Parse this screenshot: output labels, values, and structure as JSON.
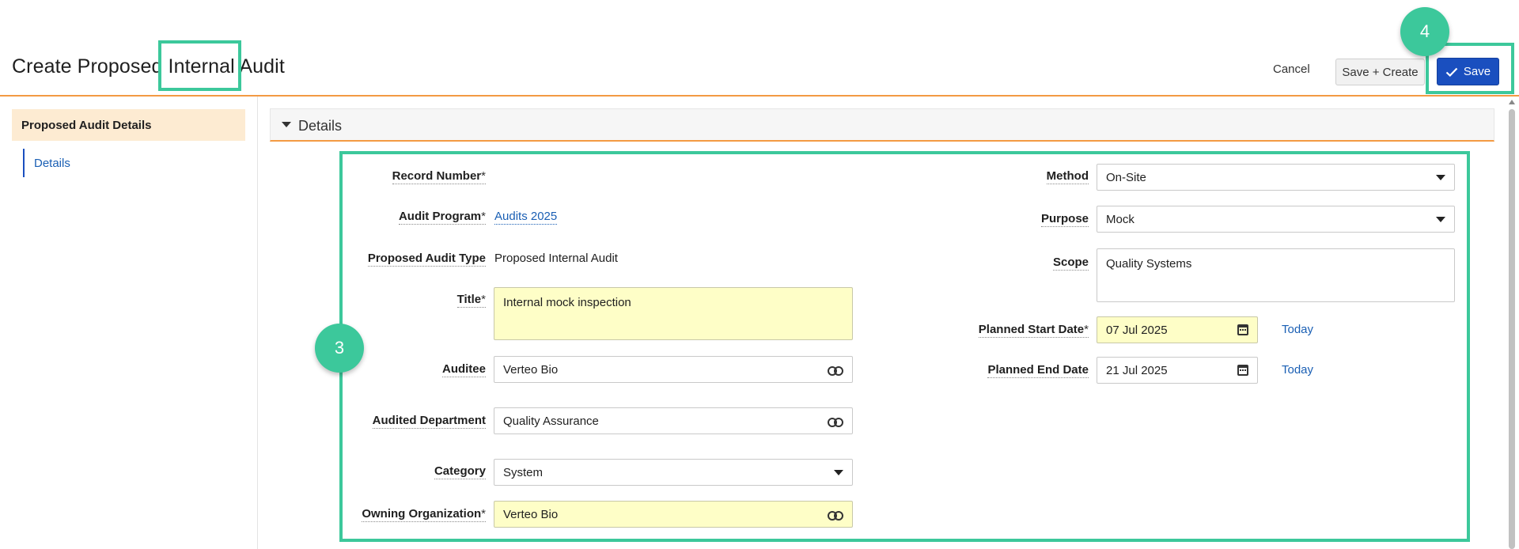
{
  "header": {
    "title": "Create Proposed Internal Audit",
    "cancel_label": "Cancel",
    "save_create_label": "Save + Create",
    "save_label": "Save"
  },
  "sidebar": {
    "section_label": "Proposed Audit Details",
    "items": [
      {
        "label": "Details"
      }
    ]
  },
  "section": {
    "title": "Details"
  },
  "form": {
    "record_number": {
      "label": "Record Number",
      "required": "*"
    },
    "audit_program": {
      "label": "Audit Program",
      "required": "*",
      "value": "Audits 2025"
    },
    "audit_type": {
      "label": "Proposed Audit Type",
      "value": "Proposed Internal Audit"
    },
    "title": {
      "label": "Title",
      "required": "*",
      "value": "Internal mock inspection"
    },
    "auditee": {
      "label": "Auditee",
      "value": "Verteo Bio"
    },
    "audited_department": {
      "label": "Audited Department",
      "value": "Quality Assurance"
    },
    "category": {
      "label": "Category",
      "value": "System"
    },
    "owning_org": {
      "label": "Owning Organization",
      "required": "*",
      "value": "Verteo Bio"
    },
    "method": {
      "label": "Method",
      "value": "On-Site"
    },
    "purpose": {
      "label": "Purpose",
      "value": "Mock"
    },
    "scope": {
      "label": "Scope",
      "value": "Quality Systems"
    },
    "planned_start": {
      "label": "Planned Start Date",
      "required": "*",
      "value": "07 Jul 2025",
      "today_label": "Today"
    },
    "planned_end": {
      "label": "Planned End Date",
      "value": "21 Jul 2025",
      "today_label": "Today"
    }
  },
  "annotations": {
    "badge_3": "3",
    "badge_4": "4",
    "color": "#3cc89b"
  },
  "colors": {
    "accent_orange": "#f39a43",
    "primary_blue": "#1a4fbf",
    "required_field": "#fefec7",
    "sidebar_active": "#fdebd2"
  }
}
